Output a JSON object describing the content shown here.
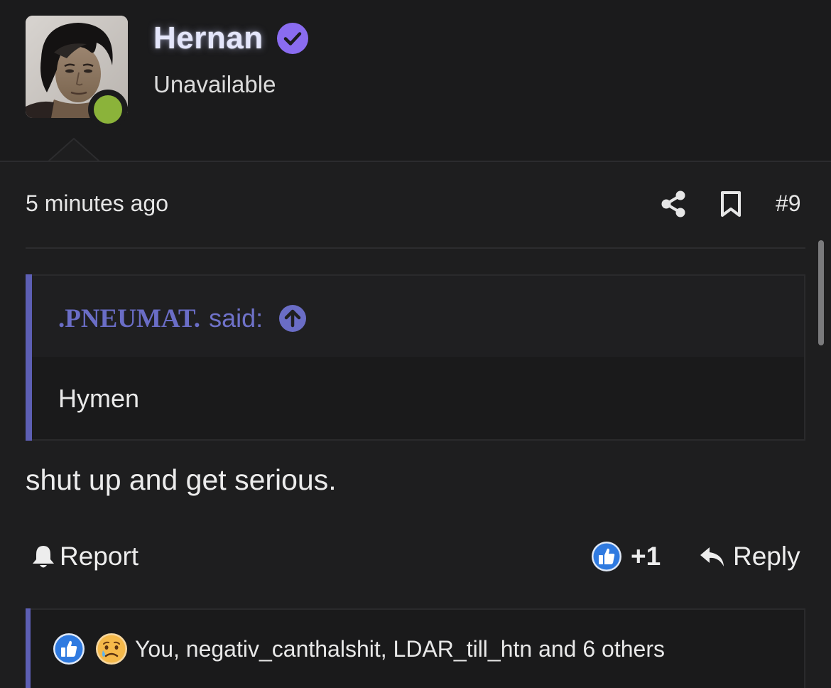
{
  "user": {
    "name": "Hernan",
    "status": "Unavailable",
    "verified_color": "#8a6cf0",
    "online_color": "#8bb33a"
  },
  "post": {
    "time": "5 minutes ago",
    "number": "#9",
    "body": "shut up and get serious."
  },
  "quote": {
    "author": ".PNEUMAT.",
    "said": "said:",
    "text": "Hymen",
    "accent_color": "#6a6dc6"
  },
  "actions": {
    "report_label": "Report",
    "like_count": "+1",
    "reply_label": "Reply"
  },
  "reactions": {
    "summary": "You, negativ_canthalshit, LDAR_till_htn and 6 others",
    "icons": [
      "like-icon",
      "sad-icon"
    ]
  },
  "icons": {
    "share": "share-icon",
    "bookmark": "bookmark-icon",
    "bell": "bell-icon",
    "reply": "reply-arrow-icon",
    "quote_jump": "arrow-up-circle-icon"
  }
}
